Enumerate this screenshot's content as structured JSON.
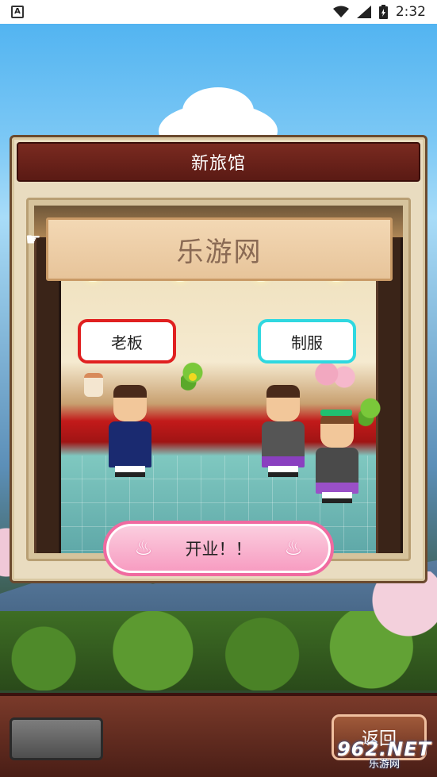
{
  "status_bar": {
    "app_indicator": "A",
    "time": "2:32",
    "icons": [
      "wifi-icon",
      "signal-icon",
      "battery-icon"
    ]
  },
  "dialog": {
    "title": "新旅馆",
    "sign_text": "乐游网",
    "choices": [
      {
        "label": "老板",
        "border_color": "#e02020"
      },
      {
        "label": "制服",
        "border_color": "#30d8e0"
      }
    ],
    "open_button_label": "开业！！"
  },
  "bottom_bar": {
    "back_label": "返回"
  },
  "watermark": {
    "main": "962.NET",
    "sub": "乐游网"
  },
  "colors": {
    "header_bg": "#6a2018",
    "open_button_border": "#f06aa0",
    "bottom_bar_bg": "#5a2a1e"
  }
}
